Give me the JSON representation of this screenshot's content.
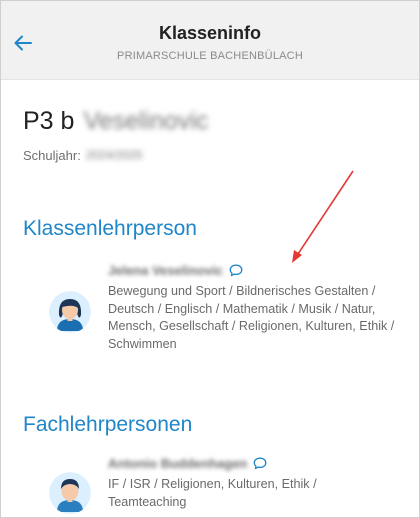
{
  "header": {
    "title": "Klasseninfo",
    "subtitle": "PRIMARSCHULE BACHENBÜLACH"
  },
  "class_info": {
    "class_label": "P3 b",
    "class_name": "Veselinovic",
    "schoolyear_label": "Schuljahr:",
    "schoolyear_value": "2024/2025"
  },
  "class_teacher": {
    "heading": "Klassenlehrperson",
    "name": "Jelena Veselinovic",
    "subjects": "Bewegung und Sport / Bildnerisches Gestalten / Deutsch / Englisch / Mathematik / Musik / Natur, Mensch, Gesellschaft / Religionen, Kulturen, Ethik / Schwimmen"
  },
  "subject_teachers": {
    "heading": "Fachlehrpersonen",
    "items": [
      {
        "name": "Antonio Buddenhagen",
        "subjects": "IF / ISR / Religionen, Kulturen, Ethik / Teamteaching"
      }
    ]
  },
  "colors": {
    "accent": "#1f86c9",
    "topbar_bg": "#f1f1f1",
    "annotation_arrow": "#e53935"
  },
  "icons": [
    "back-arrow-icon",
    "chat-bubble-icon",
    "teacher-avatar-female",
    "teacher-avatar-male"
  ]
}
